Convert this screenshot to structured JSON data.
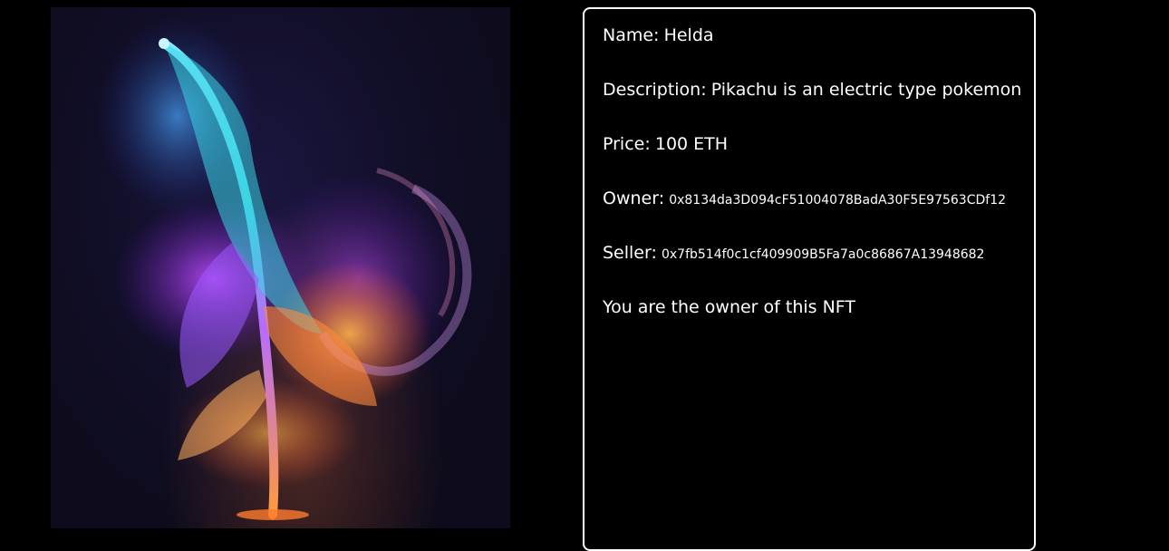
{
  "nft": {
    "image_alt": "Glowing multicolor feather artwork",
    "name_label": "Name:",
    "name": "Helda",
    "description_label": "Description:",
    "description": "Pikachu is an electric type pokemon",
    "price_label": "Price:",
    "price": "100 ETH",
    "owner_label": "Owner:",
    "owner": "0x8134da3D094cF51004078BadA30F5E97563CDf12",
    "seller_label": "Seller:",
    "seller": "0x7fb514f0c1cf409909B5Fa7a0c86867A13948682",
    "ownership_status": "You are the owner of this NFT"
  },
  "colors": {
    "background": "#000000",
    "card_border": "#ffffff",
    "text": "#ffffff"
  }
}
